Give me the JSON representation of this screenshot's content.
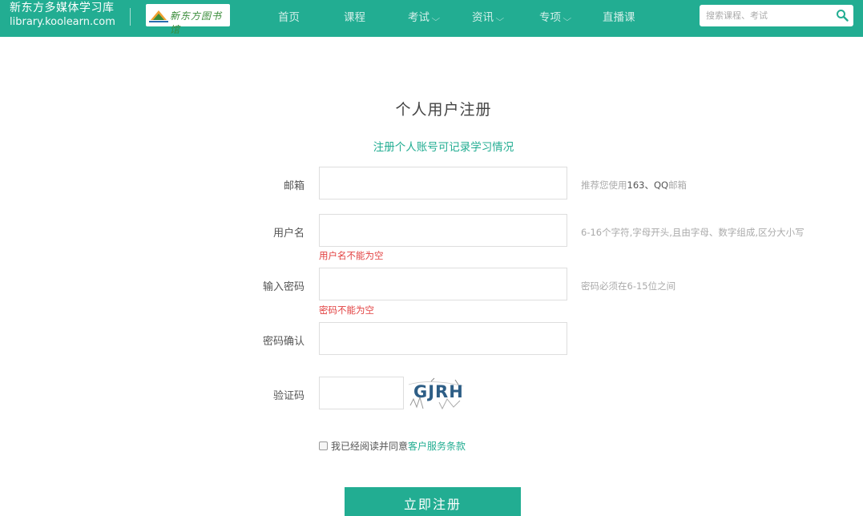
{
  "header": {
    "site_name": "新东方多媒体学习库",
    "site_url": "library.koolearn.com",
    "logo_text": "新东方图书馆",
    "nav": [
      {
        "label": "首页",
        "dropdown": false
      },
      {
        "label": "课程",
        "dropdown": false
      },
      {
        "label": "考试",
        "dropdown": true
      },
      {
        "label": "资讯",
        "dropdown": true
      },
      {
        "label": "专项",
        "dropdown": true
      },
      {
        "label": "直播课",
        "dropdown": false
      }
    ],
    "search_placeholder": "搜索课程、考试",
    "search_icon": "magnifier-icon"
  },
  "form": {
    "title": "个人用户注册",
    "subtitle": "注册个人账号可记录学习情况",
    "email": {
      "label": "邮箱",
      "value": "",
      "hint_prefix": "推荐您使用",
      "hint_bold": "163、QQ",
      "hint_suffix": "邮箱"
    },
    "username": {
      "label": "用户名",
      "value": "",
      "hint": "6-16个字符,字母开头,且由字母、数字组成,区分大小写",
      "error": "用户名不能为空"
    },
    "password": {
      "label": "输入密码",
      "value": "",
      "hint": "密码必须在6-15位之间",
      "error": "密码不能为空"
    },
    "confirm": {
      "label": "密码确认",
      "value": ""
    },
    "captcha": {
      "label": "验证码",
      "value": "",
      "image_text": "GJRH"
    },
    "agree": {
      "checked": false,
      "text": "我已经阅读并同意",
      "terms_link": "客户服务条款"
    },
    "submit_label": "立即注册"
  },
  "colors": {
    "brand": "#22ad92",
    "error": "#e24040"
  }
}
